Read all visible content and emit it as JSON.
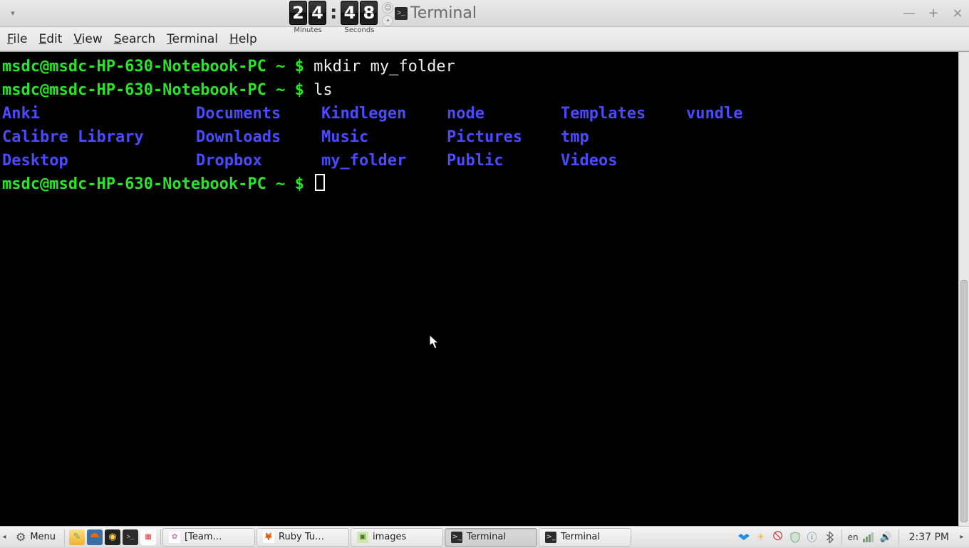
{
  "window": {
    "title": "Terminal",
    "app_icon_glyph": ">_"
  },
  "countdown": {
    "minutes_digits": [
      "2",
      "4"
    ],
    "seconds_digits": [
      "4",
      "8"
    ],
    "colon": ":",
    "minutes_label": "Minutes",
    "seconds_label": "Seconds"
  },
  "menubar": {
    "items": [
      {
        "label": "File",
        "accel_index": 0
      },
      {
        "label": "Edit",
        "accel_index": 0
      },
      {
        "label": "View",
        "accel_index": 0
      },
      {
        "label": "Search",
        "accel_index": 0
      },
      {
        "label": "Terminal",
        "accel_index": 0
      },
      {
        "label": "Help",
        "accel_index": 0
      }
    ]
  },
  "terminal": {
    "prompt_user_host": "msdc@msdc-HP-630-Notebook-PC",
    "prompt_path": "~",
    "prompt_symbol": "$",
    "commands": [
      "mkdir my_folder",
      "ls"
    ],
    "ls_rows": [
      [
        "Anki",
        "Documents",
        "Kindlegen",
        "node",
        "Templates",
        "vundle"
      ],
      [
        "Calibre Library",
        "Downloads",
        "Music",
        "Pictures",
        "tmp",
        ""
      ],
      [
        "Desktop",
        "Dropbox",
        "my_folder",
        "Public",
        "Videos",
        ""
      ]
    ]
  },
  "taskbar": {
    "menu_label": "Menu",
    "windows": [
      {
        "label": "[Team…",
        "active": false,
        "icon_bg": "#ffffff",
        "icon_fg": "#d96fbf",
        "glyph": "✿"
      },
      {
        "label": "Ruby Tu…",
        "active": false,
        "icon_bg": "#ffffff",
        "icon_fg": "#e06a19",
        "glyph": "🦊"
      },
      {
        "label": "images",
        "active": false,
        "icon_bg": "#cfe8b0",
        "icon_fg": "#4a7a1f",
        "glyph": "▣"
      },
      {
        "label": "Terminal",
        "active": true,
        "icon_bg": "#2b2b2b",
        "icon_fg": "#dddddd",
        "glyph": ">_"
      },
      {
        "label": "Terminal",
        "active": false,
        "icon_bg": "#2b2b2b",
        "icon_fg": "#dddddd",
        "glyph": ">_"
      }
    ],
    "tray": {
      "language": "en",
      "clock": "2:37 PM"
    }
  }
}
